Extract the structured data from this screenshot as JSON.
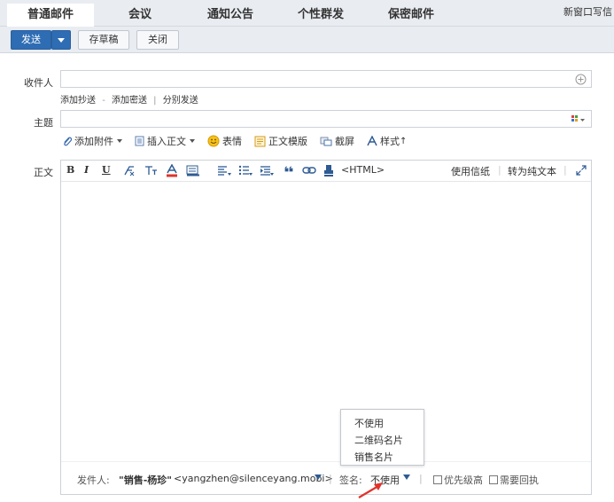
{
  "tabs": [
    {
      "label": "普通邮件",
      "active": true
    },
    {
      "label": "会议",
      "active": false
    },
    {
      "label": "通知公告",
      "active": false
    },
    {
      "label": "个性群发",
      "active": false
    },
    {
      "label": "保密邮件",
      "active": false
    }
  ],
  "new_window_label": "新窗口写信",
  "toolbar": {
    "send_label": "发送",
    "draft_label": "存草稿",
    "close_label": "关闭"
  },
  "recipient": {
    "label": "收件人",
    "value": "",
    "add_cc": "添加抄送",
    "dash": "-",
    "add_bcc": "添加密送",
    "pipe": "|",
    "separate_send": "分别发送"
  },
  "subject": {
    "label": "主题",
    "value": ""
  },
  "attach_bar": {
    "attachment": "添加附件",
    "insert_body": "插入正文",
    "emoji": "表情",
    "template": "正文模版",
    "screenshot": "截屏",
    "style": "样式"
  },
  "body": {
    "label": "正文",
    "toolbar": {
      "bold": "B",
      "italic": "I",
      "underline": "U",
      "html": "<HTML>",
      "stationery": "使用信纸",
      "pipe": "|",
      "plain_text": "转为纯文本"
    },
    "content": ""
  },
  "footer": {
    "sender_label": "发件人:",
    "sender_name": "\"销售-杨珍\"",
    "sender_email": "<yangzhen@silenceyang.mobi>",
    "signature_label": "签名:",
    "signature_value": "不使用",
    "priority_label": "优先级高",
    "receipt_label": "需要回执"
  },
  "signature_menu": {
    "options": [
      "不使用",
      "二维码名片",
      "销售名片"
    ]
  },
  "colors": {
    "accent": "#2e6db4",
    "tab_bg": "#e9ecf0",
    "arrow_red": "#e0332b"
  }
}
